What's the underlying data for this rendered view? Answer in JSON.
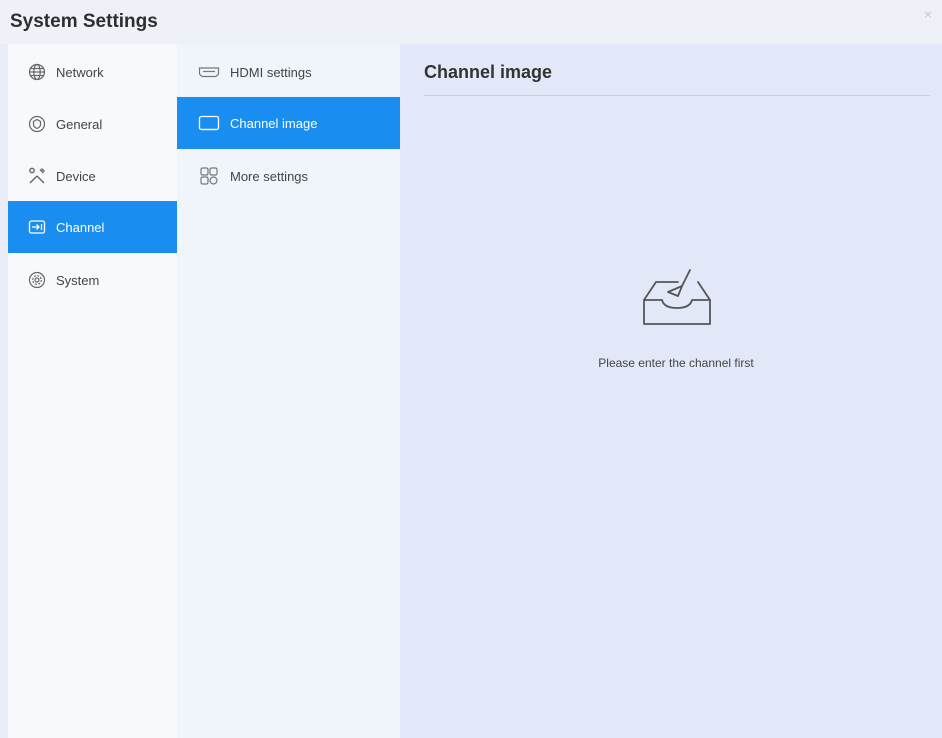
{
  "window": {
    "title": "System Settings",
    "close_symbol": "×"
  },
  "sidebar": {
    "items": [
      {
        "label": "Network",
        "icon": "globe-icon",
        "active": false
      },
      {
        "label": "General",
        "icon": "shield-icon",
        "active": false
      },
      {
        "label": "Device",
        "icon": "tools-icon",
        "active": false
      },
      {
        "label": "Channel",
        "icon": "input-icon",
        "active": true
      },
      {
        "label": "System",
        "icon": "gear-icon",
        "active": false
      }
    ]
  },
  "subnav": {
    "items": [
      {
        "label": "HDMI settings",
        "icon": "hdmi-icon",
        "active": false
      },
      {
        "label": "Channel image",
        "icon": "screen-icon",
        "active": true
      },
      {
        "label": "More settings",
        "icon": "more-settings-icon",
        "active": false
      }
    ]
  },
  "main": {
    "title": "Channel image",
    "empty_icon": "empty-inbox-icon",
    "empty_message": "Please enter the channel first"
  },
  "colors": {
    "accent": "#1a8ef0",
    "main_bg": "#e3e8f8",
    "sidebar_bg": "#f7f9fd",
    "subnav_bg": "#f0f4fb"
  }
}
